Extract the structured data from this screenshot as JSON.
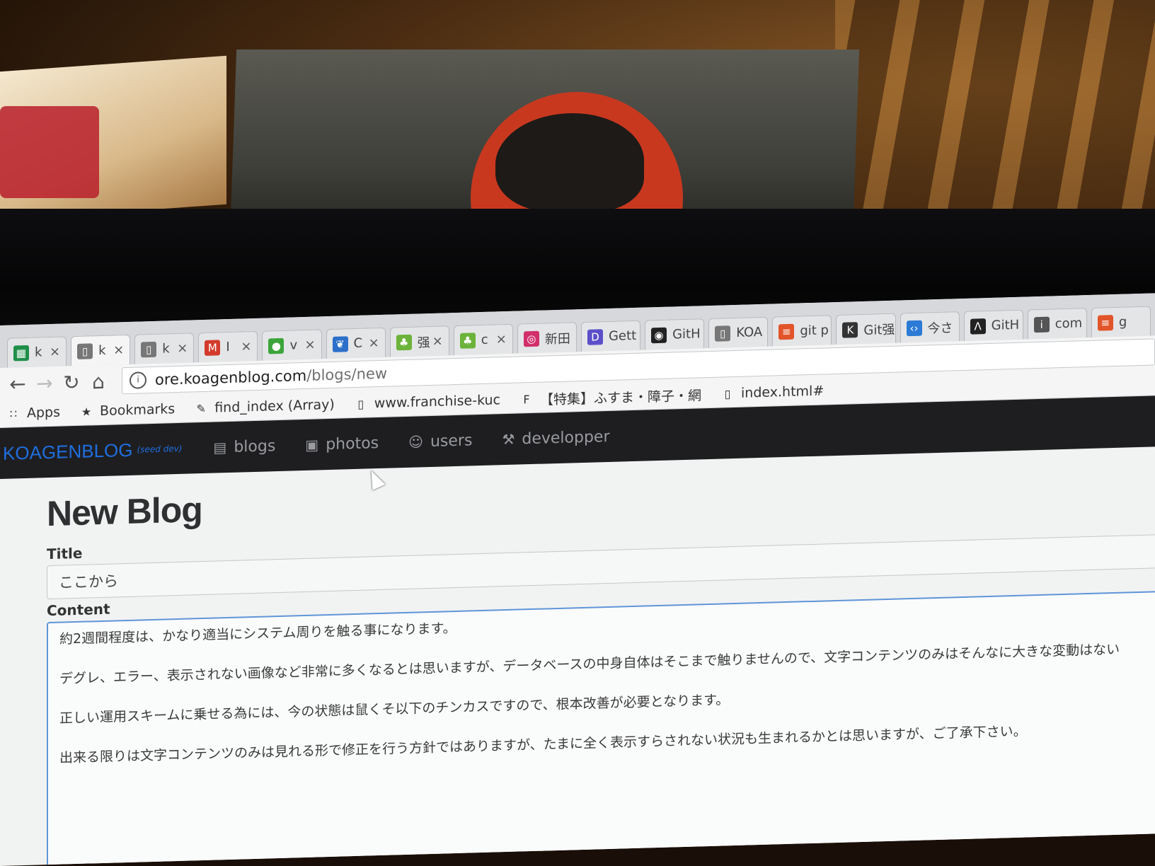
{
  "browser": {
    "tabs": [
      {
        "label": "k",
        "icon": "sheets-icon",
        "color": "#1f8f4a",
        "active": false
      },
      {
        "label": "k",
        "icon": "page-icon",
        "color": "#777777",
        "active": true
      },
      {
        "label": "k",
        "icon": "page-icon",
        "color": "#777777",
        "active": false
      },
      {
        "label": "I",
        "icon": "gmail-icon",
        "color": "#d23b2b",
        "active": false
      },
      {
        "label": "v",
        "icon": "green-circle-icon",
        "color": "#3ca43a",
        "active": false
      },
      {
        "label": "C",
        "icon": "bird-icon",
        "color": "#2c6fc9",
        "active": false
      },
      {
        "label": "强",
        "icon": "android-icon",
        "color": "#6bb33a",
        "active": false
      },
      {
        "label": "c",
        "icon": "android-icon",
        "color": "#6bb33a",
        "active": false
      },
      {
        "label": "新田",
        "icon": "instagram-icon",
        "color": "#d1306a",
        "active": false
      },
      {
        "label": "Gett",
        "icon": "d-icon",
        "color": "#5b4fc9",
        "active": false
      },
      {
        "label": "GitH",
        "icon": "github-icon",
        "color": "#222222",
        "active": false
      },
      {
        "label": "KOA",
        "icon": "page-icon",
        "color": "#777777",
        "active": false
      },
      {
        "label": "git p",
        "icon": "stack-icon",
        "color": "#e2552a",
        "active": false
      },
      {
        "label": "Git强",
        "icon": "kr-icon",
        "color": "#333333",
        "active": false
      },
      {
        "label": "今さ",
        "icon": "code-icon",
        "color": "#2b7bd6",
        "active": false
      },
      {
        "label": "GitH",
        "icon": "lambda-icon",
        "color": "#222222",
        "active": false
      },
      {
        "label": "com",
        "icon": "info-circle-icon",
        "color": "#555555",
        "active": false
      },
      {
        "label": "g",
        "icon": "stack-icon",
        "color": "#e2552a",
        "active": false
      }
    ],
    "close_glyph": "×",
    "url_host": "ore.koagenblog.com",
    "url_path": "/blogs/new",
    "bookmarks": [
      {
        "label": "Apps",
        "icon": "apps-grid-icon"
      },
      {
        "label": "Bookmarks",
        "icon": "star-icon"
      },
      {
        "label": "find_index (Array)",
        "icon": "ruby-pencil-icon"
      },
      {
        "label": "www.franchise-kuc",
        "icon": "page-icon"
      },
      {
        "label": "【特集】ふすま・障子・網",
        "icon": "f-green-icon"
      },
      {
        "label": "index.html#",
        "icon": "page-icon"
      }
    ]
  },
  "site": {
    "brand": "KOAGENBLOG",
    "brand_sub": "(seed dev)",
    "brand_color": "#1f6fe0",
    "nav": [
      {
        "label": "blogs",
        "icon": "book-icon"
      },
      {
        "label": "photos",
        "icon": "picture-icon"
      },
      {
        "label": "users",
        "icon": "user-icon"
      },
      {
        "label": "developper",
        "icon": "wrench-icon"
      }
    ]
  },
  "form": {
    "page_title": "New Blog",
    "title_label": "Title",
    "title_value": "ここから",
    "content_label": "Content",
    "content_lines": [
      "約2週間程度は、かなり適当にシステム周りを触る事になります。",
      "デグレ、エラー、表示されない画像など非常に多くなるとは思いますが、データベースの中身自体はそこまで触りませんので、文字コンテンツのみはそんなに大きな変動はない",
      "正しい運用スキームに乗せる為には、今の状態は鼠くそ以下のチンカスですので、根本改善が必要となります。",
      "出来る限りは文字コンテンツのみは見れる形で修正を行う方針ではありますが、たまに全く表示すらされない状況も生まれるかとは思いますが、ご了承下さい。"
    ]
  }
}
